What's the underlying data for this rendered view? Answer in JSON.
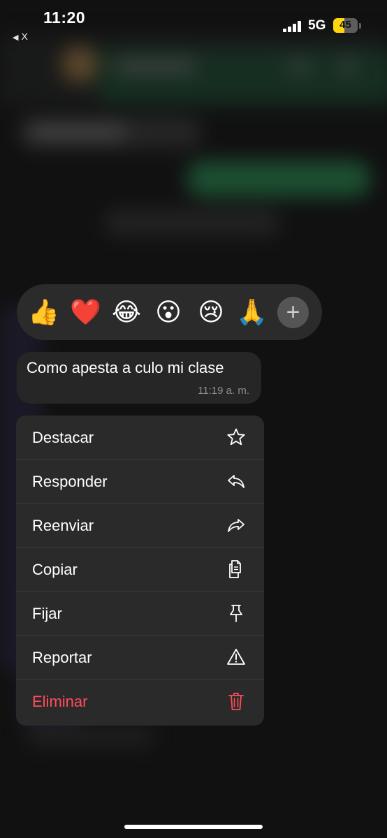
{
  "status_bar": {
    "time": "11:20",
    "back_label": "X",
    "network": "5G",
    "battery": "45",
    "battery_level": 0.45
  },
  "reactions": {
    "emojis": [
      {
        "glyph": "👍",
        "icon": "thumbs-up-icon"
      },
      {
        "glyph": "❤️",
        "icon": "heart-icon"
      },
      {
        "glyph": "😂",
        "icon": "tears-of-joy-icon"
      },
      {
        "glyph": "😮",
        "icon": "surprised-face-icon"
      },
      {
        "glyph": "😢",
        "icon": "crying-face-icon"
      },
      {
        "glyph": "🙏",
        "icon": "folded-hands-icon"
      }
    ],
    "add_glyph": "+"
  },
  "message": {
    "text": "Como apesta a culo mi clase",
    "time": "11:19 a. m."
  },
  "menu": {
    "items": [
      {
        "label": "Destacar",
        "icon": "star-icon"
      },
      {
        "label": "Responder",
        "icon": "reply-icon"
      },
      {
        "label": "Reenviar",
        "icon": "forward-icon"
      },
      {
        "label": "Copiar",
        "icon": "copy-icon"
      },
      {
        "label": "Fijar",
        "icon": "pin-icon"
      },
      {
        "label": "Reportar",
        "icon": "warning-icon"
      },
      {
        "label": "Eliminar",
        "icon": "trash-icon",
        "danger": true
      }
    ]
  },
  "colors": {
    "danger": "#ff4d5a",
    "battery_accent": "#ffd60a"
  }
}
